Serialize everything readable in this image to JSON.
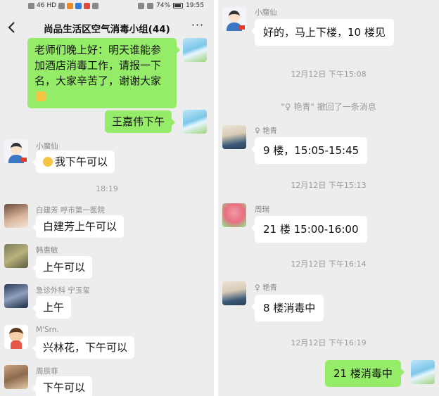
{
  "status_bar": {
    "carrier_icons": "46 HD",
    "battery": "74%",
    "time": "19:55"
  },
  "chat": {
    "title": "尚品生活区空气消毒小组(44)"
  },
  "left_messages": {
    "m1": {
      "text": "老师们晚上好：明天谁能参加酒店消毒工作，请报一下名，大家辛苦了，谢谢大家"
    },
    "m2": {
      "text": "王嘉伟下午"
    },
    "m3": {
      "sender": "小魔仙",
      "text": "我下午可以"
    },
    "ts1": "18:19",
    "m4": {
      "sender": "白建芳  呼市第一医院",
      "text": "白建芳上午可以"
    },
    "m5": {
      "sender": "韩惠敏",
      "text": "上午可以"
    },
    "m6": {
      "sender": "急诊外科  宁玉玺",
      "text": "上午"
    },
    "m7": {
      "sender": "M'Srn.",
      "text": "兴林花，下午可以"
    },
    "m8": {
      "sender": "周辰菲",
      "text": "下午可以"
    }
  },
  "right_messages": {
    "r1": {
      "sender": "小魔仙",
      "text": "好的，马上下楼，10 楼见"
    },
    "ts1": "12月12日 下午15:08",
    "recall": "\"♀ 艳青\" 撤回了一条消息",
    "r2": {
      "sender": "♀ 艳青",
      "text": "9 楼，15:05-15:45"
    },
    "ts2": "12月12日 下午15:13",
    "r3": {
      "sender": "周瑞",
      "text": "21 楼 15:00-16:00"
    },
    "ts3": "12月12日 下午16:14",
    "r4": {
      "sender": "♀ 艳青",
      "text": "8 楼消毒中"
    },
    "ts4": "12月12日 下午16:19",
    "r5": {
      "text": "21 楼消毒中"
    }
  },
  "icons": {
    "back": "chevron-left-icon",
    "more": "more-dots-icon"
  }
}
